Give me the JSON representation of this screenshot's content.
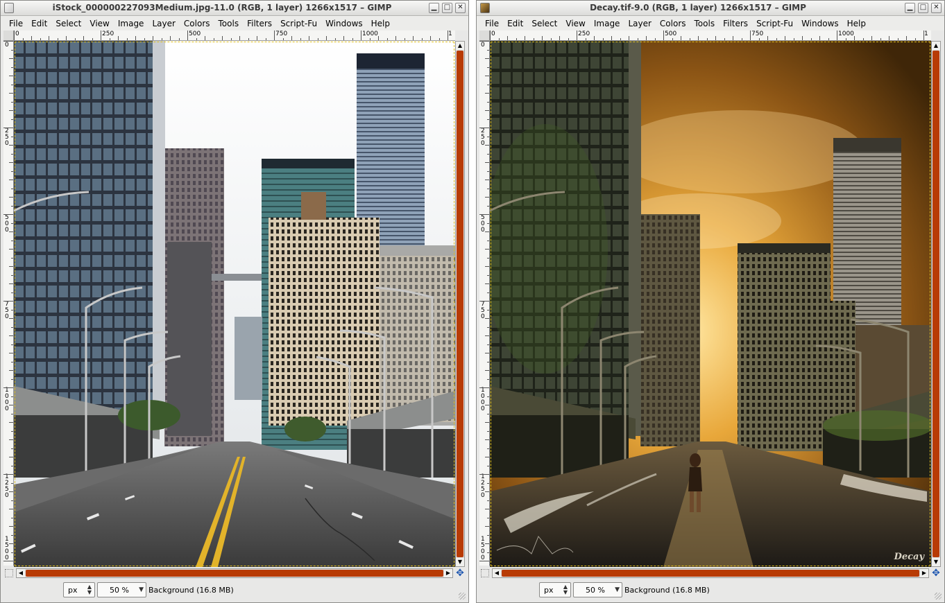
{
  "windows": [
    {
      "id": "left",
      "title": "iStock_000000227093Medium.jpg-11.0 (RGB, 1 layer) 1266x1517 – GIMP",
      "menu": [
        "File",
        "Edit",
        "Select",
        "View",
        "Image",
        "Layer",
        "Colors",
        "Tools",
        "Filters",
        "Script-Fu",
        "Windows",
        "Help"
      ],
      "ruler_h": [
        "0",
        "250",
        "500",
        "750",
        "1000",
        "1"
      ],
      "ruler_v": [
        "0",
        "250",
        "500",
        "750",
        "1000",
        "1250",
        "1500"
      ],
      "status": {
        "unit": "px",
        "zoom": "50 %",
        "layer_info": "Background (16.8 MB)"
      }
    },
    {
      "id": "right",
      "title": "Decay.tif-9.0 (RGB, 1 layer) 1266x1517 – GIMP",
      "menu": [
        "File",
        "Edit",
        "Select",
        "View",
        "Image",
        "Layer",
        "Colors",
        "Tools",
        "Filters",
        "Script-Fu",
        "Windows",
        "Help"
      ],
      "ruler_h": [
        "0",
        "250",
        "500",
        "750",
        "1000",
        "1"
      ],
      "ruler_v": [
        "0",
        "250",
        "500",
        "750",
        "1000",
        "1250",
        "1500"
      ],
      "status": {
        "unit": "px",
        "zoom": "50 %",
        "layer_info": "Background (16.8 MB)"
      },
      "artwork_watermark": "Decay"
    }
  ],
  "icons": {
    "minimize": "minimize-icon",
    "maximize": "maximize-icon",
    "close": "close-icon",
    "navigate": "navigate-icon",
    "quick_mask": "quick-mask-icon"
  },
  "colors": {
    "scrollbar_thumb": "#b83b05",
    "selection_marching_ants": "#e0c020",
    "window_bg": "#e8e8e7"
  }
}
